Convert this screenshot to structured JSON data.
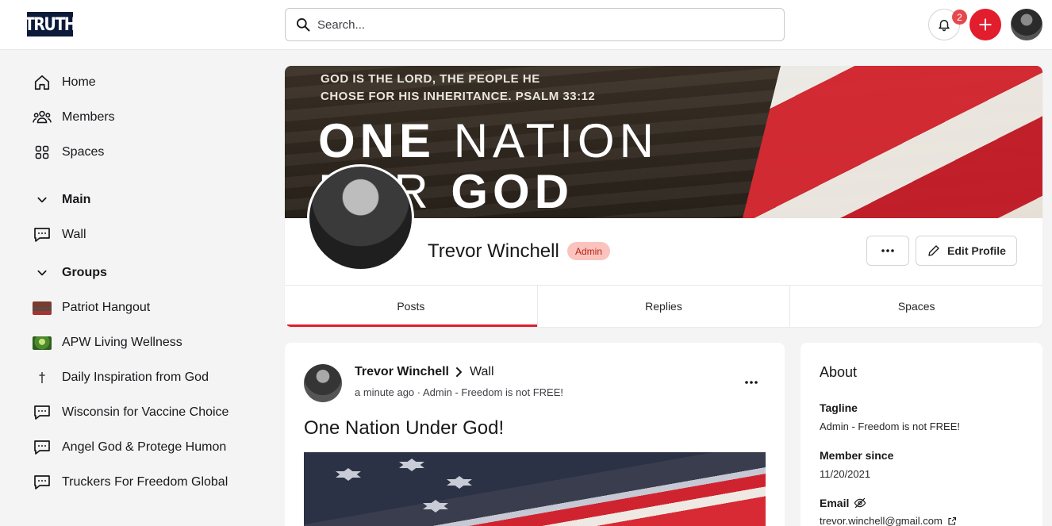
{
  "app": {
    "logo_text": "TRUTH"
  },
  "header": {
    "search_placeholder": "Search...",
    "notification_count": "2",
    "icons": [
      "search-icon",
      "bell-icon",
      "plus-icon",
      "user-avatar"
    ]
  },
  "sidebar": {
    "items": [
      {
        "label": "Home",
        "icon": "home-icon"
      },
      {
        "label": "Members",
        "icon": "members-icon"
      },
      {
        "label": "Spaces",
        "icon": "spaces-icon"
      }
    ],
    "main_section": {
      "label": "Main",
      "items": [
        {
          "label": "Wall",
          "icon": "chat-icon"
        }
      ]
    },
    "groups_section": {
      "label": "Groups",
      "items": [
        {
          "label": "Patriot Hangout",
          "icon": "group-thumbnail"
        },
        {
          "label": "APW Living Wellness",
          "icon": "group-thumbnail"
        },
        {
          "label": "Daily Inspiration from God",
          "icon": "cross-icon"
        },
        {
          "label": "Wisconsin for Vaccine Choice",
          "icon": "chat-icon"
        },
        {
          "label": "Angel God & Protege Humon",
          "icon": "chat-icon"
        },
        {
          "label": "Truckers For Freedom Global",
          "icon": "chat-icon"
        }
      ]
    }
  },
  "profile": {
    "cover_text": {
      "line1": "GOD IS THE LORD, THE PEOPLE HE",
      "line2": "CHOSE FOR HIS INHERITANCE. PSALM 33:12",
      "big1_bold": "ONE",
      "big1_rest": " NATION",
      "big2_rest": "DER ",
      "big2_bold": "GOD"
    },
    "name": "Trevor Winchell",
    "role_badge": "Admin",
    "edit_label": "Edit Profile",
    "tabs": [
      "Posts",
      "Replies",
      "Spaces"
    ],
    "active_tab": "Posts"
  },
  "post": {
    "author": "Trevor Winchell",
    "destination": "Wall",
    "meta": "a minute ago · Admin - Freedom is not FREE!",
    "title": "One Nation Under God!"
  },
  "about": {
    "title": "About",
    "tagline_label": "Tagline",
    "tagline_value": "Admin - Freedom is not FREE!",
    "member_since_label": "Member since",
    "member_since_value": "11/20/2021",
    "email_label": "Email",
    "email_value": "trevor.winchell@gmail.com"
  },
  "colors": {
    "accent": "#e11d2e",
    "badge_bg": "#fbc3bd",
    "badge_text": "#b42318"
  }
}
